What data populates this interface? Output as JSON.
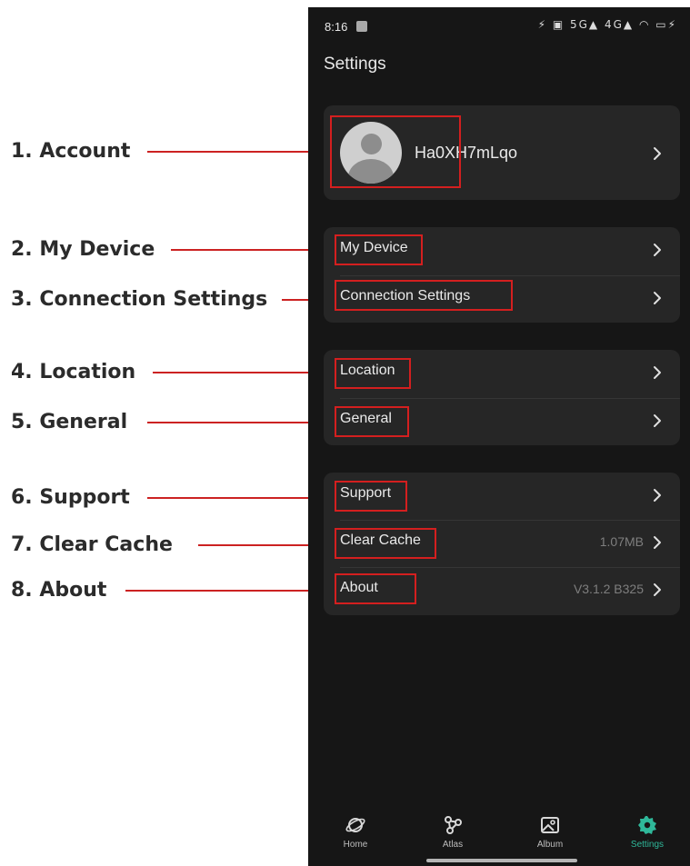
{
  "annotations": [
    {
      "label": "1. Account"
    },
    {
      "label": "2. My Device"
    },
    {
      "label": "3. Connection Settings"
    },
    {
      "label": "4. Location"
    },
    {
      "label": "5. General"
    },
    {
      "label": "6. Support"
    },
    {
      "label": "7. Clear Cache"
    },
    {
      "label": "8. About"
    }
  ],
  "status_bar": {
    "time": "8:16",
    "indicators": "⚡ ▣ 5G▲ 4G▲ ◠ ▭⚡"
  },
  "page": {
    "title": "Settings"
  },
  "account": {
    "username": "Ha0XH7mLqo"
  },
  "groups": [
    {
      "rows": [
        {
          "label": "My Device"
        },
        {
          "label": "Connection Settings"
        }
      ]
    },
    {
      "rows": [
        {
          "label": "Location"
        },
        {
          "label": "General"
        }
      ]
    },
    {
      "rows": [
        {
          "label": "Support"
        },
        {
          "label": "Clear Cache",
          "value": "1.07MB"
        },
        {
          "label": "About",
          "value": "V3.1.2 B325"
        }
      ]
    }
  ],
  "tabs": [
    {
      "label": "Home",
      "icon": "planet-icon"
    },
    {
      "label": "Atlas",
      "icon": "graph-icon"
    },
    {
      "label": "Album",
      "icon": "image-icon"
    },
    {
      "label": "Settings",
      "icon": "gear-icon",
      "active": true
    }
  ],
  "colors": {
    "accent": "#2fb89a",
    "highlight": "#d41f1f",
    "background": "#161616",
    "card": "#262626"
  }
}
